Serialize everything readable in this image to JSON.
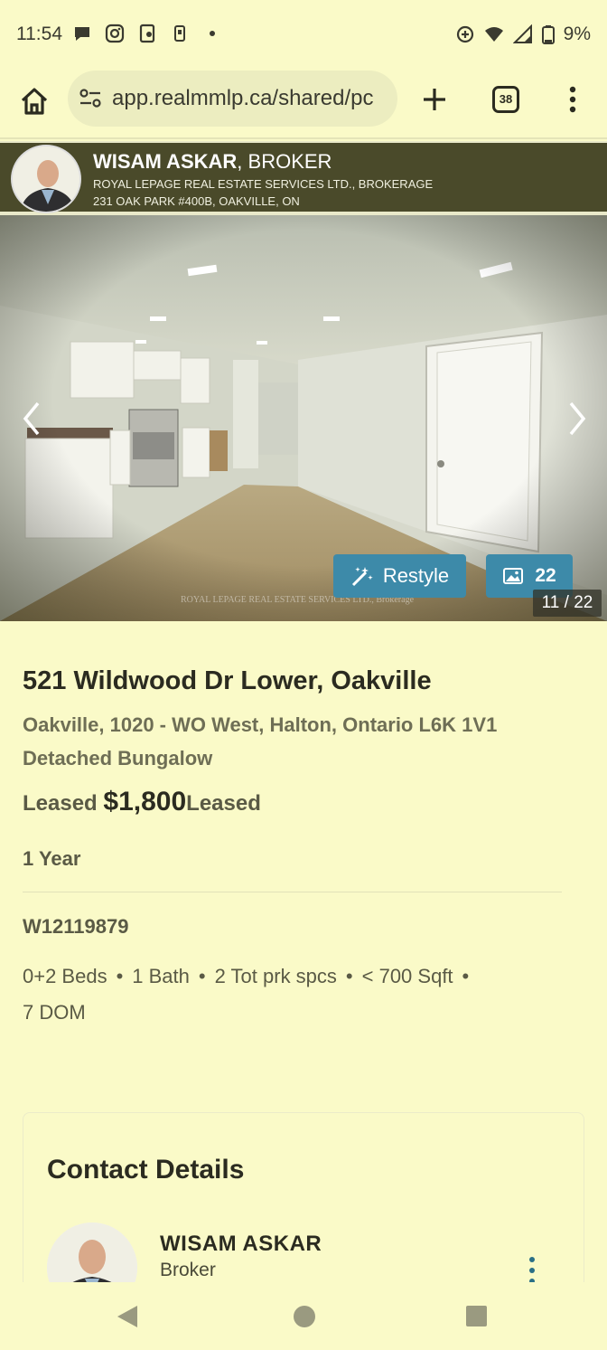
{
  "status": {
    "time": "11:54",
    "battery": "9%"
  },
  "browser": {
    "url": "app.realmmlp.ca/shared/pc",
    "tab_count": "38"
  },
  "agent_header": {
    "name": "WISAM ASKAR",
    "title": ", BROKER",
    "brokerage": "ROYAL LEPAGE REAL ESTATE SERVICES LTD., BROKERAGE",
    "address": "231 OAK PARK #400B, OAKVILLE, ON"
  },
  "photo": {
    "restyle_label": "Restyle",
    "photo_count": "22",
    "counter": "11 / 22",
    "watermark": "ROYAL LEPAGE REAL ESTATE SERVICES LTD., Brokerage"
  },
  "listing": {
    "address": "521 Wildwood Dr Lower, Oakville",
    "area": "Oakville, 1020 - WO West, Halton, Ontario L6K 1V1",
    "type": "Detached Bungalow",
    "status_before": "Leased ",
    "price": "$1,800",
    "status_after": "Leased",
    "term": "1 Year",
    "mls": "W12119879",
    "beds": "0+2 Beds",
    "baths": "1 Bath",
    "parking": "2 Tot prk spcs",
    "sqft": "< 700 Sqft",
    "dom": "7 DOM"
  },
  "contact": {
    "title": "Contact Details",
    "name": "WISAM ASKAR",
    "role": "Broker"
  }
}
